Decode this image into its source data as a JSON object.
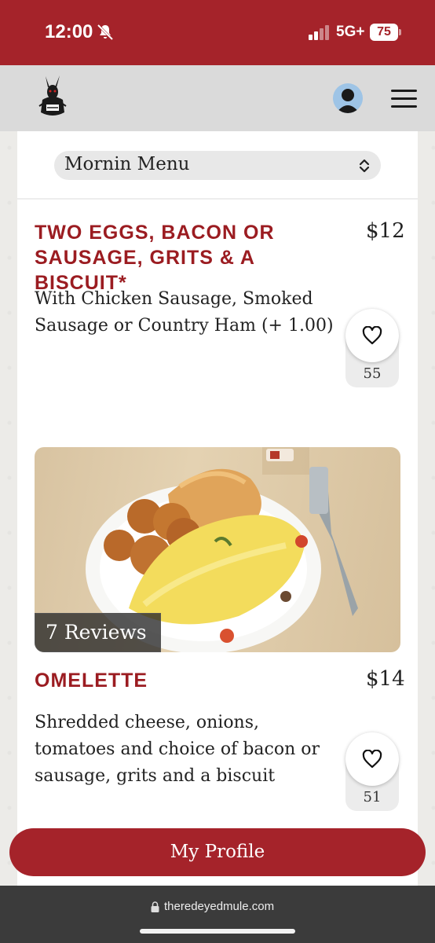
{
  "status_bar": {
    "time": "12:00",
    "network": "5G+",
    "battery": "75"
  },
  "header": {
    "logo": "red-eyed-mule-logo",
    "avatar": "user-avatar-icon",
    "menu": "hamburger-menu-icon"
  },
  "menu_select": {
    "selected": "Mornin Menu"
  },
  "items": [
    {
      "title": "TWO EGGS, BACON OR SAUSAGE, GRITS & A BISCUIT*",
      "price": "$12",
      "description": "With Chicken Sausage, Smoked Sausage or Country Ham (+ 1.00)",
      "likes": "55"
    },
    {
      "title": "OMELETTE",
      "price": "$14",
      "description": "Shredded cheese, onions, tomatoes and choice of bacon or sausage, grits and a biscuit",
      "likes": "51",
      "reviews": "7 Reviews"
    }
  ],
  "profile_button": "My Profile",
  "browser": {
    "url": "theredeyedmule.com"
  },
  "colors": {
    "brand_red": "#a5232a",
    "title_red": "#9b1c21"
  }
}
